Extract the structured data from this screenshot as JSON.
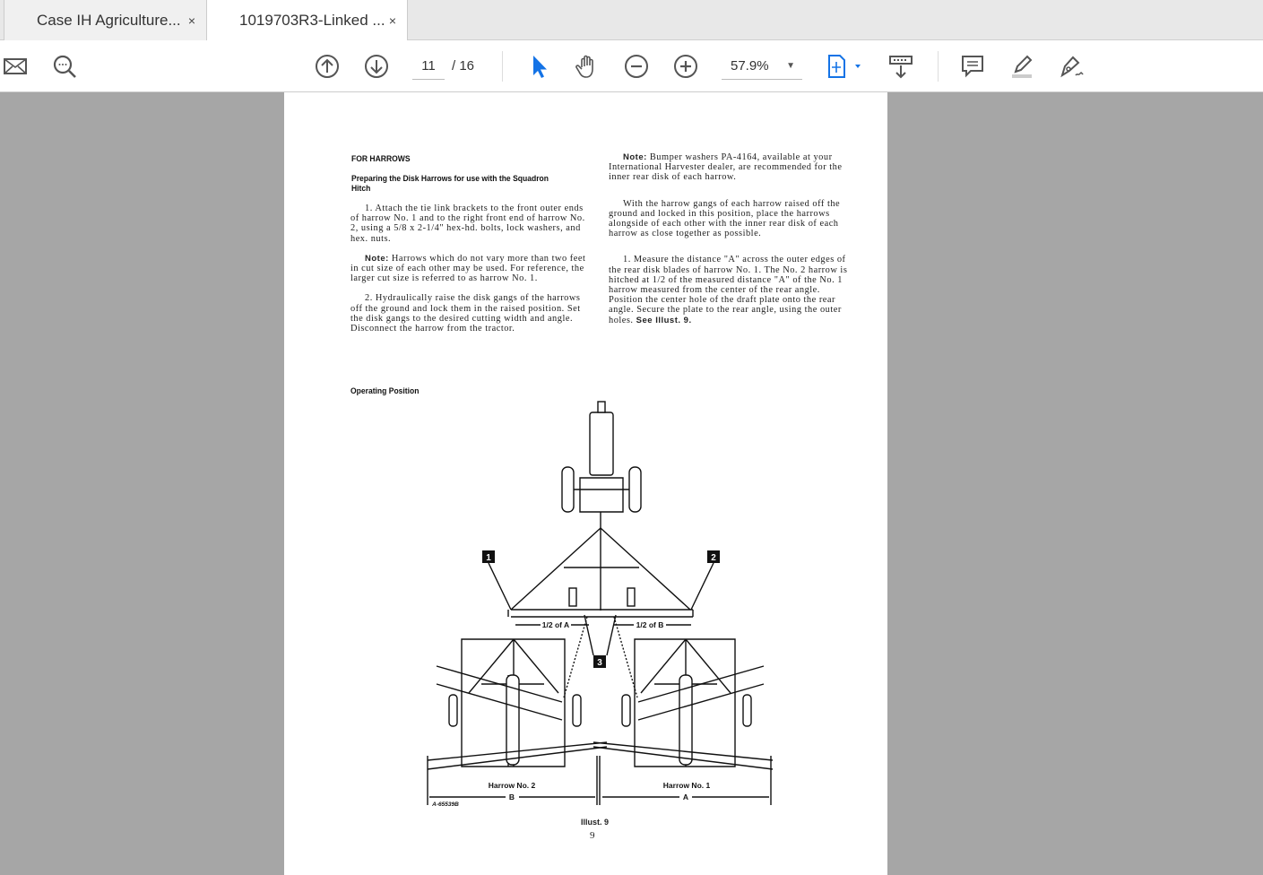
{
  "tabs": [
    {
      "label": "Case IH Agriculture...",
      "close": "×"
    },
    {
      "label": "1019703R3-Linked ...",
      "close": "×"
    }
  ],
  "toolbar": {
    "page_current": "11",
    "page_total": "/ 16",
    "zoom": "57.9%",
    "icons": [
      "mail-icon",
      "search-icon",
      "page-up-icon",
      "page-down-icon",
      "select-cursor-icon",
      "hand-icon",
      "zoom-out-icon",
      "zoom-in-icon",
      "fit-page-icon",
      "scroll-mode-icon",
      "comment-icon",
      "highlight-icon",
      "sign-icon"
    ],
    "accent": "#1473e6"
  },
  "document": {
    "heading": "FOR HARROWS",
    "subheading": "Preparing the Disk Harrows for use with the Squadron Hitch",
    "left_paragraphs": [
      {
        "lead": "",
        "text": "1. Attach the tie link brackets to the front outer ends of harrow No. 1 and to the right front end of harrow No. 2, using a 5/8 x 2-1/4\" hex-hd. bolts, lock washers, and hex. nuts."
      },
      {
        "lead": "Note:",
        "text": " Harrows which do not vary more than two feet in cut size of each other may be used. For reference, the larger cut size is referred to as harrow No. 1."
      },
      {
        "lead": "",
        "text": "2. Hydraulically raise the disk gangs of the harrows off the ground and lock them in the raised position. Set the disk gangs to the desired cutting width and angle. Disconnect the harrow from the tractor."
      }
    ],
    "right_paragraphs": [
      {
        "lead": "Note:",
        "text": " Bumper washers PA-4164, available at your International Harvester dealer, are recommended for the inner rear disk of each harrow."
      },
      {
        "lead": "",
        "text": "With the harrow gangs of each harrow raised off the ground and locked in this position, place the harrows alongside of each other with the inner rear disk of each harrow as close together as possible."
      },
      {
        "lead": "",
        "text": "1. Measure the distance \"A\" across the outer edges of the rear disk blades of harrow No. 1. The No. 2 harrow is hitched at 1/2 of the measured distance \"A\" of the No. 1 harrow measured from the center of the rear angle. Position the center hole of the draft plate onto the rear angle. Secure the plate to the rear angle, using the outer holes.",
        "tail": " See Illust. 9."
      }
    ],
    "section": "Operating Position",
    "illustration": {
      "callouts": [
        "1",
        "2",
        "3"
      ],
      "half_a": "1/2 of A",
      "half_b": "1/2 of B",
      "harrow2": "Harrow No. 2",
      "harrow1": "Harrow No. 1",
      "dim_b": "B",
      "dim_a": "A",
      "code": "A-65539B",
      "caption": "Illust. 9"
    },
    "page_number": "9"
  }
}
